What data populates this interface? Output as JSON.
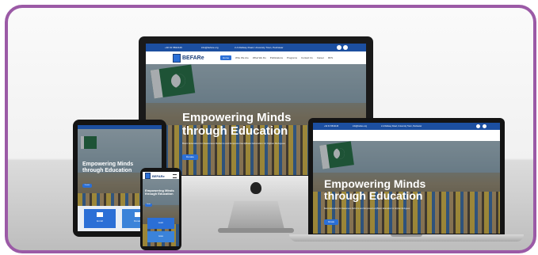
{
  "site": {
    "logo_text": "BEFARe",
    "hero_title_line1": "Empowering Minds",
    "hero_title_line2": "through Education",
    "hero_subtitle": "Basic Education for Awareness Reforms and Empowerment|Basic Education for Afghan Refugees",
    "cta_label": "Donate",
    "nav": [
      "Home",
      "Who We Are",
      "What We Do",
      "Publications",
      "Programs",
      "Contact Us",
      "Career",
      "RFS"
    ],
    "topbar_phone": "+92 91 5842146",
    "topbar_email": "info@befare.org",
    "topbar_address": "2-A Railway Road, University Town, Peshawar"
  },
  "tablet_cards": [
    "Enroll",
    "Donate"
  ],
  "phone_cards": [
    "Learn",
    "Grow"
  ],
  "colors": {
    "frame": "#9b5aa6",
    "brand_blue": "#2b6fd6",
    "topbar": "#1c4fa0"
  }
}
